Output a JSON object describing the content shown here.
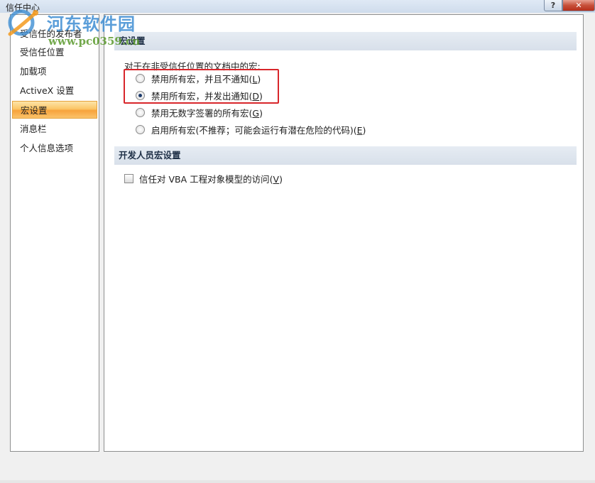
{
  "window": {
    "title": "信任中心",
    "help_label": "?",
    "close_label": "✕"
  },
  "watermark": {
    "brand": "河东软件园",
    "url": "www.pc0359.cn"
  },
  "sidebar": {
    "items": [
      {
        "label": "受信任的发布者",
        "selected": false
      },
      {
        "label": "受信任位置",
        "selected": false
      },
      {
        "label": "加载项",
        "selected": false
      },
      {
        "label": "ActiveX 设置",
        "selected": false
      },
      {
        "label": "宏设置",
        "selected": true
      },
      {
        "label": "消息栏",
        "selected": false
      },
      {
        "label": "个人信息选项",
        "selected": false
      }
    ]
  },
  "macro_section": {
    "header": "宏设置",
    "prompt": "对于在非受信任位置的文档中的宏:",
    "options": [
      {
        "text": "禁用所有宏，并且不通知(",
        "key": "L",
        "suffix": ")",
        "checked": false
      },
      {
        "text": "禁用所有宏，并发出通知(",
        "key": "D",
        "suffix": ")",
        "checked": true
      },
      {
        "text": "禁用无数字签署的所有宏(",
        "key": "G",
        "suffix": ")",
        "checked": false
      },
      {
        "text": "启用所有宏(不推荐；可能会运行有潜在危险的代码)(",
        "key": "E",
        "suffix": ")",
        "checked": false
      }
    ]
  },
  "developer_section": {
    "header": "开发人员宏设置",
    "checkbox": {
      "text": "信任对 VBA 工程对象模型的访问(",
      "key": "V",
      "suffix": ")",
      "checked": false
    }
  },
  "colors": {
    "selection_orange": "#fbc566",
    "highlight_red": "#d8262b",
    "section_header_bg": "#dfe6ef"
  }
}
